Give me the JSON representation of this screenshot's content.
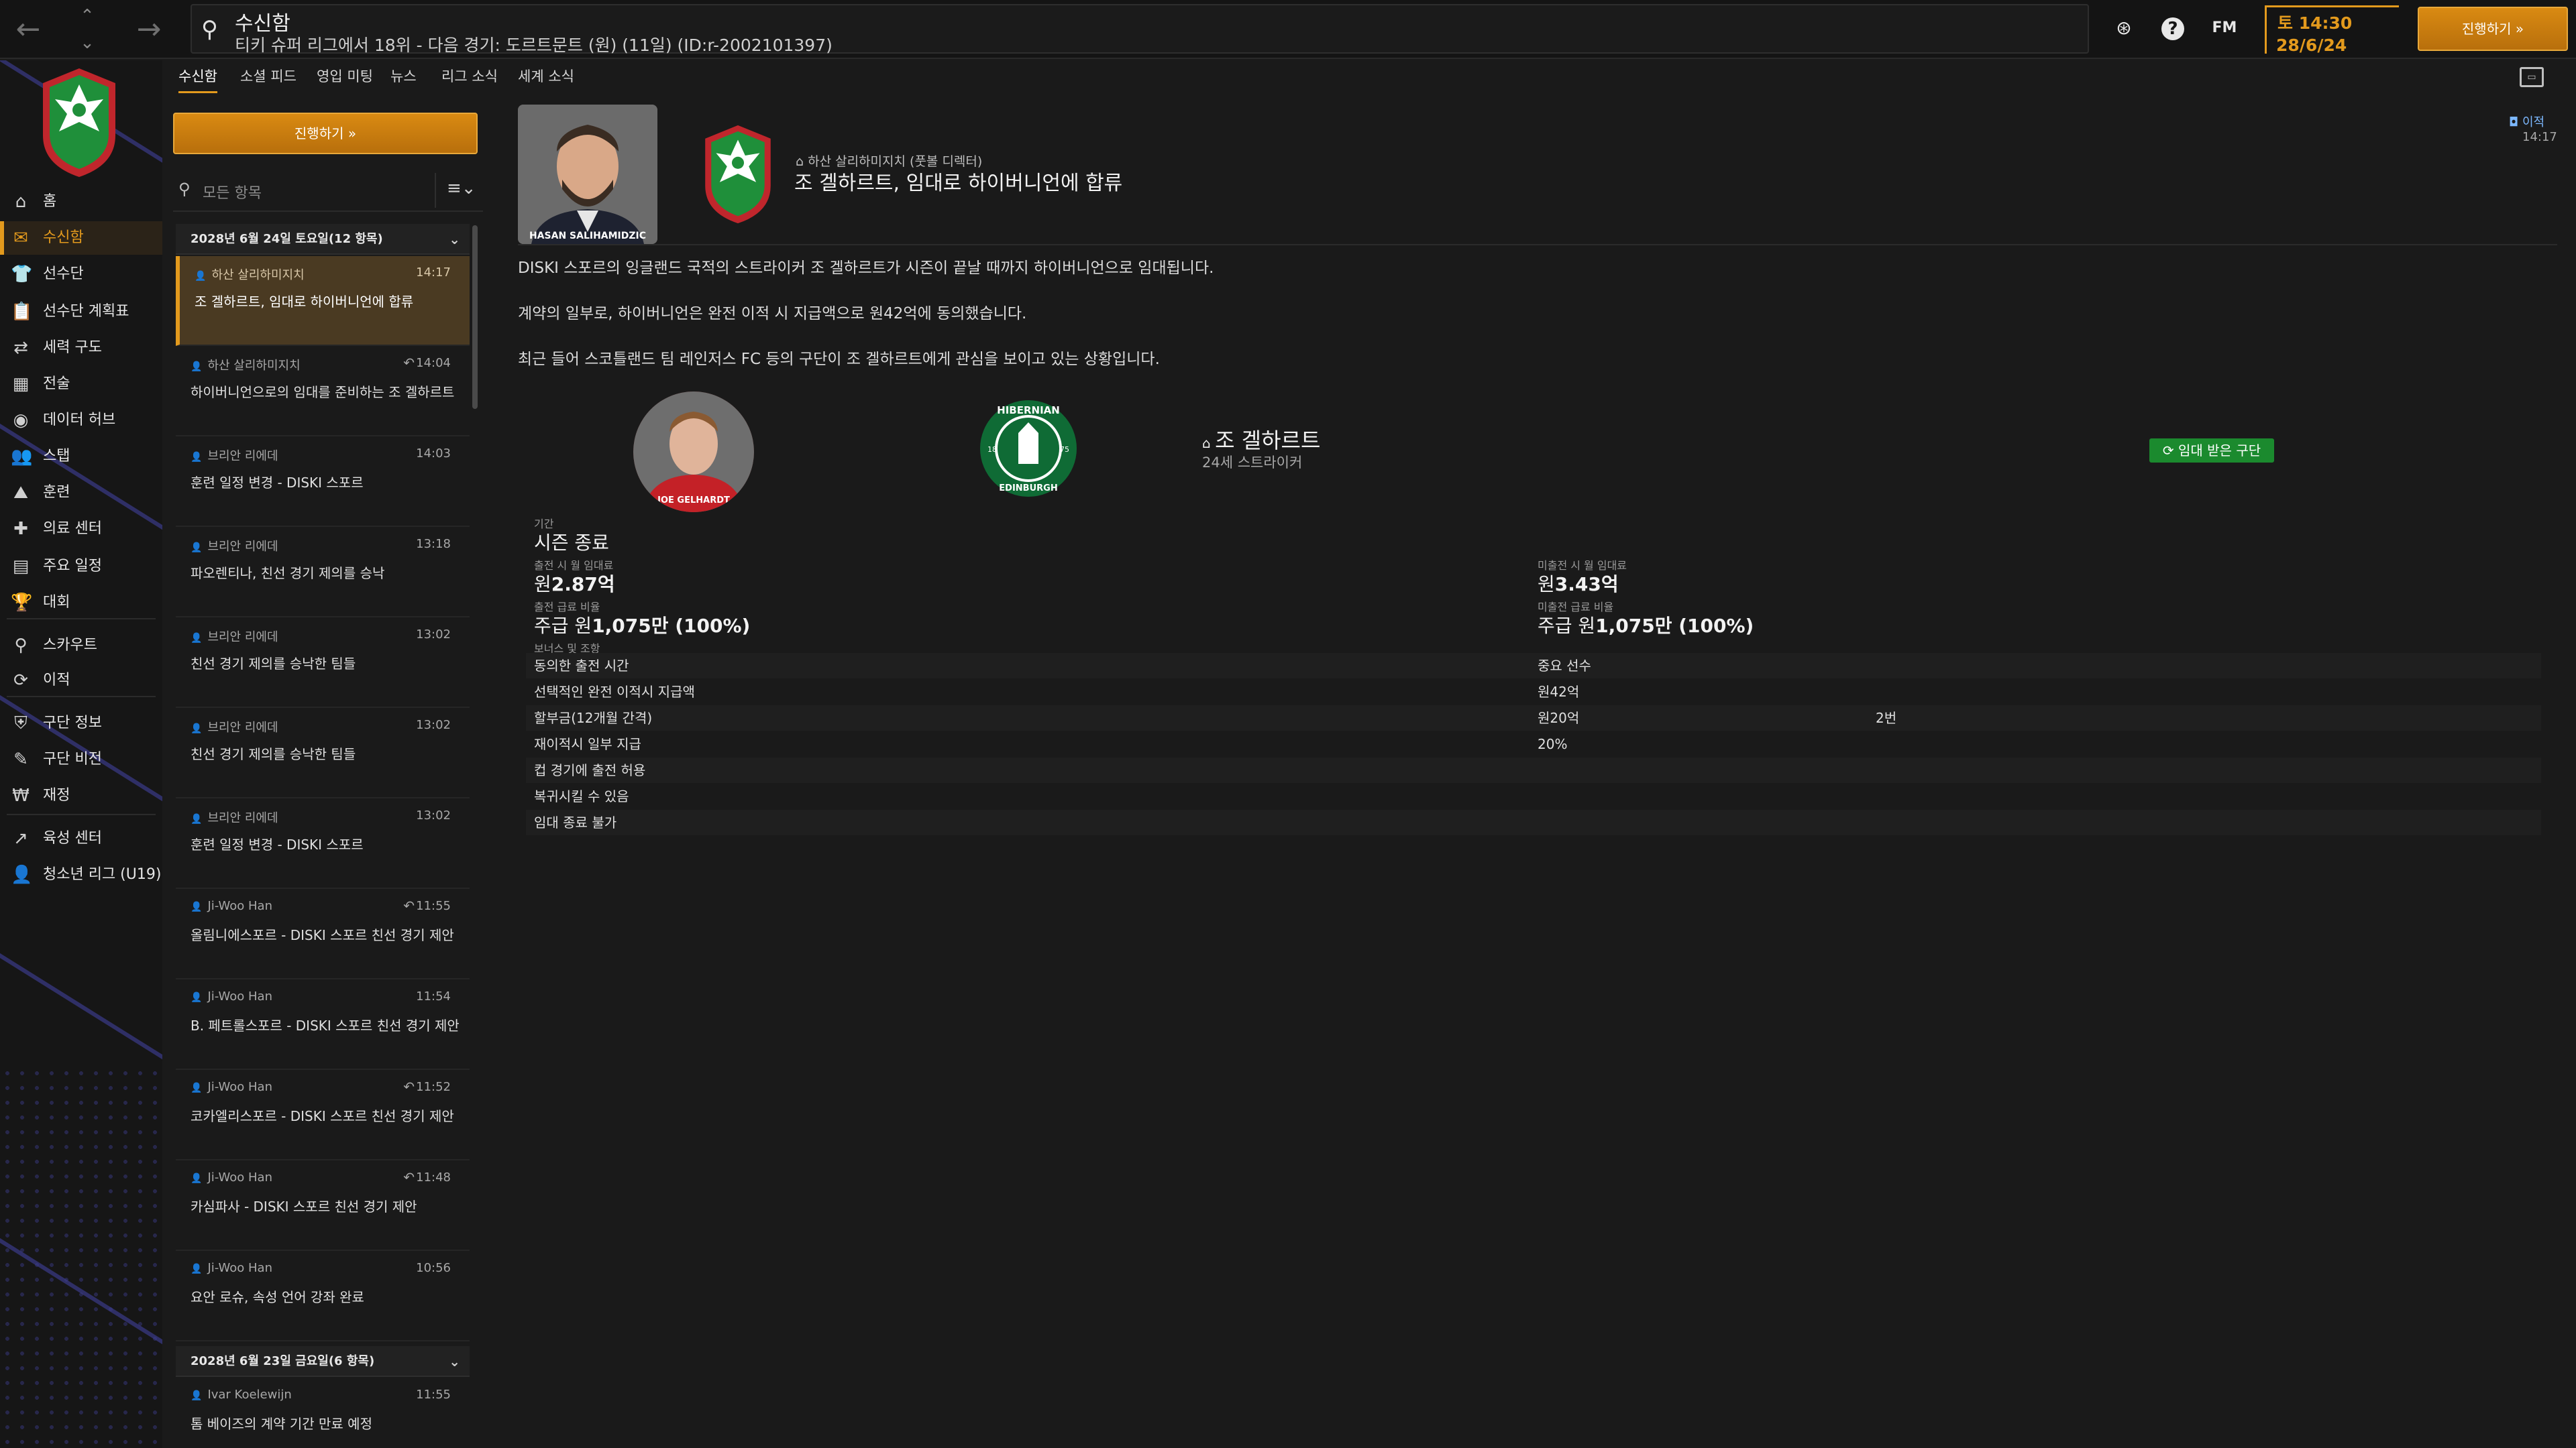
{
  "topbar": {
    "title": "수신함",
    "subtitle": "티키 슈퍼 리그에서 18위 - 다음 경기: 도르트문트 (원) (11일) (ID:r-2002101397)",
    "day": "토 14:30",
    "date": "28/6/24",
    "fm_label": "FM",
    "help_label": "?",
    "continue_label": "진행하기 »"
  },
  "sidebar": {
    "items": [
      {
        "icon": "home-icon",
        "glyph": "⌂",
        "label": "홈"
      },
      {
        "icon": "inbox-icon",
        "glyph": "✉",
        "label": "수신함"
      },
      {
        "icon": "squad-icon",
        "glyph": "👕",
        "label": "선수단"
      },
      {
        "icon": "squad-planner-icon",
        "glyph": "📋",
        "label": "선수단 계획표"
      },
      {
        "icon": "dynamics-icon",
        "glyph": "⇄",
        "label": "세력 구도"
      },
      {
        "icon": "tactics-icon",
        "glyph": "▦",
        "label": "전술"
      },
      {
        "icon": "data-hub-icon",
        "glyph": "◉",
        "label": "데이터 허브"
      },
      {
        "icon": "staff-icon",
        "glyph": "👥",
        "label": "스탭"
      },
      {
        "icon": "training-icon",
        "glyph": "⛰",
        "label": "훈련"
      },
      {
        "icon": "medical-icon",
        "glyph": "✚",
        "label": "의료 센터"
      },
      {
        "icon": "schedule-icon",
        "glyph": "▤",
        "label": "주요 일정"
      },
      {
        "icon": "trophy-icon",
        "glyph": "🏆",
        "label": "대회"
      },
      {
        "icon": "scouting-icon",
        "glyph": "⚲",
        "label": "스카우트"
      },
      {
        "icon": "transfers-icon",
        "glyph": "⟳",
        "label": "이적"
      },
      {
        "icon": "club-info-icon",
        "glyph": "⛨",
        "label": "구단 정보"
      },
      {
        "icon": "club-vision-icon",
        "glyph": "✎",
        "label": "구단 비전"
      },
      {
        "icon": "finances-icon",
        "glyph": "₩",
        "label": "재정"
      },
      {
        "icon": "development-icon",
        "glyph": "↗",
        "label": "육성 센터"
      },
      {
        "icon": "youth-league-icon",
        "glyph": "👤",
        "label": "청소년 리그 (U19)"
      }
    ]
  },
  "tabs": [
    "수신함",
    "소셜 피드",
    "영입 미팅",
    "뉴스",
    "리그 소식",
    "세계 소식"
  ],
  "inbox": {
    "continue_label": "진행하기 »",
    "filter_placeholder": "모든 항목",
    "groups": [
      {
        "header": "2028년 6월 24일 토요일(12 항목)",
        "messages": [
          {
            "from": "하산 살리하미지치",
            "time": "14:17",
            "subject": "조 겔하르트, 임대로 하이버니언에 합류",
            "reply": ""
          },
          {
            "from": "하산 살리하미지치",
            "time": "14:04",
            "subject": "하이버니언으로의 임대를 준비하는 조 겔하르트",
            "reply": "↶"
          },
          {
            "from": "브리안 리에데",
            "time": "14:03",
            "subject": "훈련 일정 변경 - DISKI 스포르",
            "reply": ""
          },
          {
            "from": "브리안 리에데",
            "time": "13:18",
            "subject": "파오렌티나, 친선 경기 제의를 승낙",
            "reply": ""
          },
          {
            "from": "브리안 리에데",
            "time": "13:02",
            "subject": "친선 경기 제의를 승낙한 팀들",
            "reply": ""
          },
          {
            "from": "브리안 리에데",
            "time": "13:02",
            "subject": "친선 경기 제의를 승낙한 팀들",
            "reply": ""
          },
          {
            "from": "브리안 리에데",
            "time": "13:02",
            "subject": "훈련 일정 변경 - DISKI 스포르",
            "reply": ""
          },
          {
            "from": "Ji-Woo Han",
            "time": "11:55",
            "subject": "올림니에스포르 - DISKI 스포르 친선 경기 제안",
            "reply": "↶"
          },
          {
            "from": "Ji-Woo Han",
            "time": "11:54",
            "subject": "B. 페트롤스포르 - DISKI 스포르 친선 경기 제안",
            "reply": ""
          },
          {
            "from": "Ji-Woo Han",
            "time": "11:52",
            "subject": "코카엘리스포르 - DISKI 스포르 친선 경기 제안",
            "reply": "↶"
          },
          {
            "from": "Ji-Woo Han",
            "time": "11:48",
            "subject": "카심파사 - DISKI 스포르 친선 경기 제안",
            "reply": "↶"
          },
          {
            "from": "Ji-Woo Han",
            "time": "10:56",
            "subject": "요안 로슈, 속성 언어 강좌 완료",
            "reply": ""
          }
        ]
      },
      {
        "header": "2028년 6월 23일 금요일(6 항목)",
        "messages": [
          {
            "from": "Ivar Koelewijn",
            "time": "11:55",
            "subject": "톰 베이즈의 계약 기간 만료 예정",
            "reply": ""
          }
        ]
      }
    ]
  },
  "detail": {
    "manager_caption": "HASAN SALIHAMIDZIC",
    "sender": "하산 살리하미지치 (풋볼 디렉터)",
    "headline": "조 겔하르트, 임대로 하이버니언에 합류",
    "tag": "이적",
    "time": "14:17",
    "paragraphs": [
      "DISKI 스포르의 잉글랜드 국적의 스트라이커 조 겔하르트가 시즌이 끝날 때까지 하이버니언으로 임대됩니다.",
      "계약의 일부로, 하이버니언은 완전 이적 시 지급액으로 원42억에 동의했습니다.",
      "최근 들어 스코틀랜드 팀 레인저스 FC 등의 구단이 조 겔하르트에게 관심을 보이고 있는 상황입니다."
    ],
    "player": {
      "caption": "JOE GELHARDT",
      "name": "조 겔하르트",
      "meta": "24세 스트라이커",
      "hibs_top": "HIBERNIAN",
      "hibs_bottom": "EDINBURGH",
      "hibs_left": "18",
      "hibs_right": "75",
      "badge": "임대 받은 구단"
    },
    "terms": {
      "period_label": "기간",
      "period_value": "시즌 종료",
      "fee_played_label": "출전 시 월 임대료",
      "fee_played_prefix": "원",
      "fee_played_value": "2.87억",
      "fee_unplayed_label": "미출전 시 월 임대료",
      "fee_unplayed_prefix": "원",
      "fee_unplayed_value": "3.43억",
      "wage_played_label": "출전 급료 비율",
      "wage_played_prefix": "주급 원",
      "wage_played_value": "1,075만 (100%)",
      "wage_unplayed_label": "미출전 급료 비율",
      "wage_unplayed_prefix": "주급 원",
      "wage_unplayed_value": "1,075만 (100%)",
      "bonus_label": "보너스 및 조항",
      "rows": [
        [
          "동의한 출전 시간",
          "중요 선수",
          ""
        ],
        [
          "선택적인 완전 이적시 지급액",
          "원42억",
          ""
        ],
        [
          "할부금(12개월 간격)",
          "원20억",
          "2번"
        ],
        [
          "재이적시 일부 지급",
          "20%",
          ""
        ],
        [
          "컵 경기에 출전 허용",
          "",
          ""
        ],
        [
          "복귀시킬 수 있음",
          "",
          ""
        ],
        [
          "임대 종료 불가",
          "",
          ""
        ]
      ]
    }
  },
  "colors": {
    "accent": "#e39a1d",
    "background": "#1a1a1a",
    "sidebar": "#161616",
    "loan_badge": "#1b8a2e",
    "club_green": "#1f8f3a",
    "club_red": "#c0262c"
  }
}
